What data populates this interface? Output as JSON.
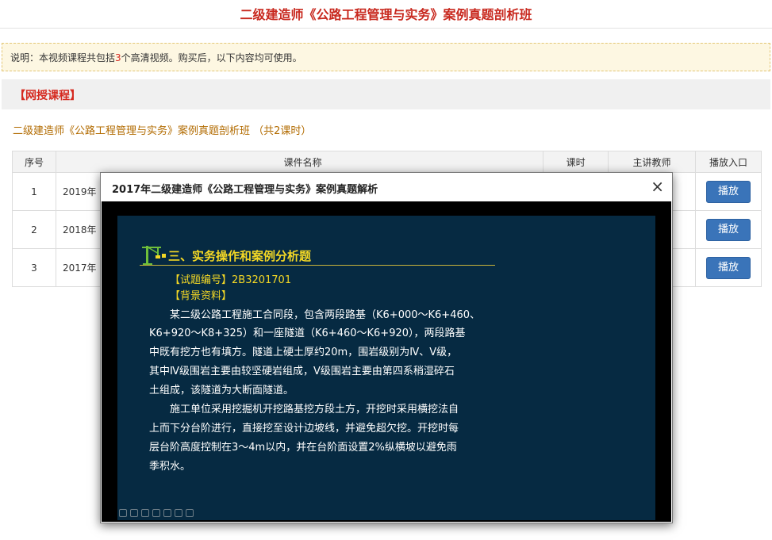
{
  "page": {
    "title": "二级建造师《公路工程管理与实务》案例真题剖析班"
  },
  "notice": {
    "prefix": "说明：本视频课程共包括",
    "count": "3",
    "suffix": "个高清视频。购买后，以下内容均可使用。"
  },
  "section": {
    "title": "【网授课程】"
  },
  "course": {
    "heading": "二级建造师《公路工程管理与实务》案例真题剖析班 （共2课时）"
  },
  "table": {
    "headers": {
      "index": "序号",
      "name": "课件名称",
      "hours": "课时",
      "teacher": "主讲教师",
      "play": "播放入口"
    },
    "rows": [
      {
        "index": "1",
        "name": "2019年",
        "play_label": "播放"
      },
      {
        "index": "2",
        "name": "2018年",
        "play_label": "播放"
      },
      {
        "index": "3",
        "name": "2017年",
        "play_label": "播放"
      }
    ]
  },
  "modal": {
    "title": "2017年二级建造师《公路工程管理与实务》案例真题解析",
    "close": "×",
    "slide": {
      "heading": "三、实务操作和案例分析题",
      "lines": [
        "【试题编号】2B3201701",
        "【背景资料】",
        "某二级公路工程施工合同段，包含两段路基（K6+000～K6+460、",
        "K6+920～K8+325）和一座隧道（K6+460～K6+920），两段路基",
        "中既有挖方也有填方。隧道上硬土厚约20m，围岩级别为Ⅳ、Ⅴ级，",
        "其中Ⅳ级围岩主要由较坚硬岩组成，Ⅴ级围岩主要由第四系稍湿碎石",
        "土组成，该隧道为大断面隧道。",
        "施工单位采用挖掘机开挖路基挖方段土方，开挖时采用横挖法自",
        "上而下分台阶进行，直接挖至设计边坡线，并避免超欠挖。开挖时每",
        "层台阶高度控制在3～4m以内，并在台阶面设置2%纵横坡以避免雨",
        "季积水。"
      ]
    }
  },
  "colors": {
    "title_red": "#c8281e",
    "play_button": "#3a74b9",
    "slide_bg": "#062a42",
    "slide_yellow": "#f4d825"
  },
  "icons": {
    "crane": "crane-icon",
    "close": "close-icon"
  }
}
